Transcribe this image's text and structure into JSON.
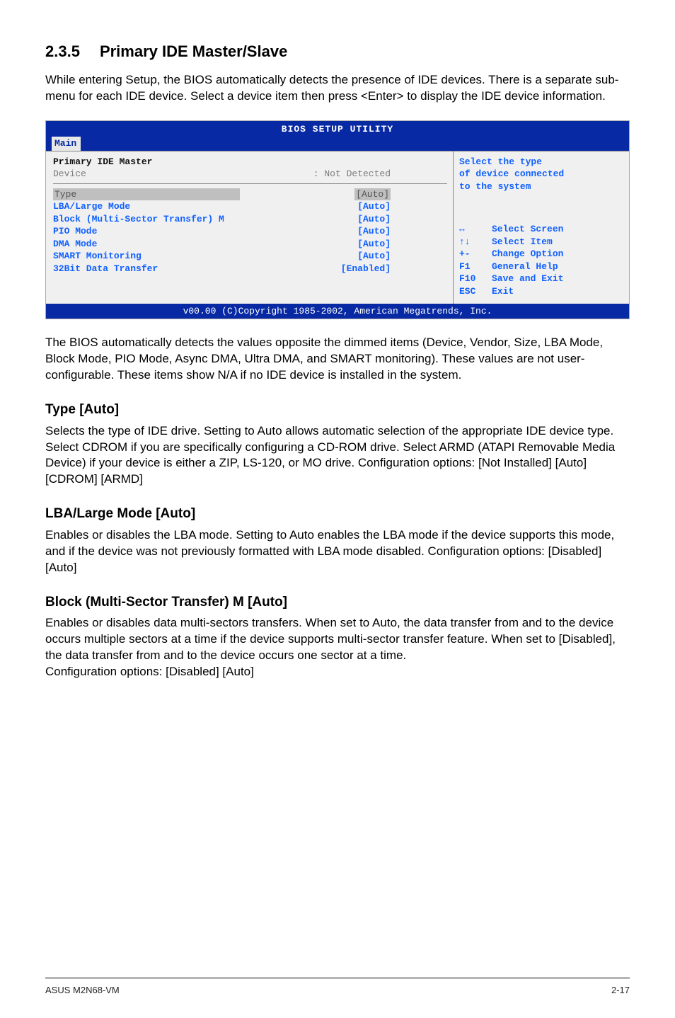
{
  "section_number": "2.3.5",
  "section_title": "Primary IDE Master/Slave",
  "intro": "While entering Setup, the BIOS automatically detects the presence of IDE devices. There is a separate sub-menu for each IDE device. Select a device item then press <Enter> to display the IDE device information.",
  "bios": {
    "title": "BIOS SETUP UTILITY",
    "tab": "Main",
    "header_left": "Primary IDE Master",
    "device_row": {
      "label": "Device",
      "value": ": Not Detected"
    },
    "options": [
      {
        "label": "Type",
        "value": "[Auto]",
        "highlight": true
      },
      {
        "label": "LBA/Large Mode",
        "value": "[Auto]",
        "highlight": false
      },
      {
        "label": "Block (Multi-Sector Transfer) M",
        "value": "[Auto]",
        "highlight": false
      },
      {
        "label": "PIO Mode",
        "value": "[Auto]",
        "highlight": false
      },
      {
        "label": "DMA Mode",
        "value": "[Auto]",
        "highlight": false
      },
      {
        "label": "SMART Monitoring",
        "value": "[Auto]",
        "highlight": false
      },
      {
        "label": "32Bit Data Transfer",
        "value": "[Enabled]",
        "highlight": false
      }
    ],
    "help_text_1": "Select the type",
    "help_text_2": "of device connected",
    "help_text_3": "to the system",
    "legend": [
      {
        "key": "↔",
        "action": "Select Screen"
      },
      {
        "key": "↑↓",
        "action": "Select Item"
      },
      {
        "key": "+-",
        "action": "Change Option"
      },
      {
        "key": "F1",
        "action": "General Help"
      },
      {
        "key": "F10",
        "action": "Save and Exit"
      },
      {
        "key": "ESC",
        "action": "Exit"
      }
    ],
    "footer": "v00.00 (C)Copyright 1985-2002, American Megatrends, Inc."
  },
  "post_bios": "The BIOS automatically detects the values opposite the dimmed items (Device, Vendor, Size, LBA Mode, Block Mode, PIO Mode, Async DMA, Ultra DMA, and SMART monitoring). These values are not user-configurable. These items show N/A if no IDE device is installed in the system.",
  "type": {
    "heading": "Type [Auto]",
    "body": "Selects the type of IDE drive. Setting to Auto allows automatic selection of the appropriate IDE device type. Select CDROM if you are specifically configuring a CD-ROM drive. Select ARMD (ATAPI Removable Media Device) if your device is either a ZIP, LS-120, or MO drive. Configuration options: [Not Installed] [Auto] [CDROM] [ARMD]"
  },
  "lba": {
    "heading": "LBA/Large Mode [Auto]",
    "body": "Enables or disables the LBA mode. Setting to Auto enables the LBA mode if the device supports this mode, and if the device was not previously formatted with LBA mode disabled. Configuration options: [Disabled] [Auto]"
  },
  "block": {
    "heading": "Block (Multi-Sector Transfer) M [Auto]",
    "body": "Enables or disables data multi-sectors transfers. When set to Auto, the data transfer from and to the device occurs multiple sectors at a time if the device supports multi-sector transfer feature. When set to [Disabled], the data transfer from and to the device occurs one sector at a time.\nConfiguration options: [Disabled] [Auto]"
  },
  "footer_left": "ASUS M2N68-VM",
  "footer_right": "2-17"
}
